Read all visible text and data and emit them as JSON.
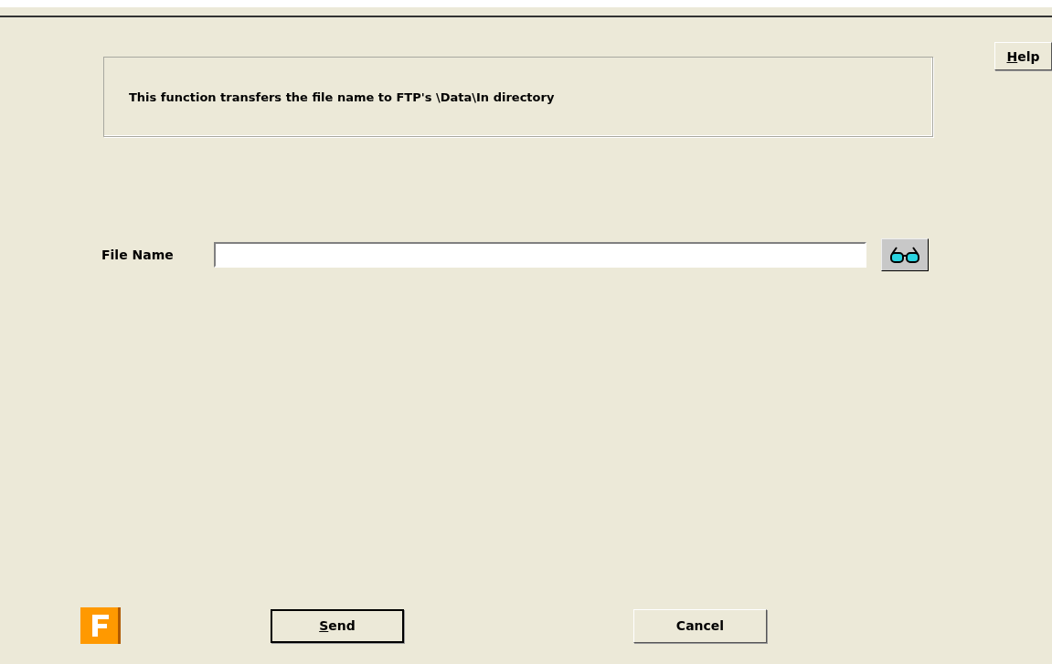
{
  "help_button": {
    "label": "Help",
    "underline_first": true
  },
  "info": {
    "text": "This function transfers the file name to FTP's \\Data\\In directory"
  },
  "file_name": {
    "label": "File Name"
  },
  "buttons": [
    {
      "label": "Send",
      "underline_first": true,
      "default": true
    },
    {
      "label": "Cancel",
      "underline_first": false,
      "default": false
    }
  ]
}
